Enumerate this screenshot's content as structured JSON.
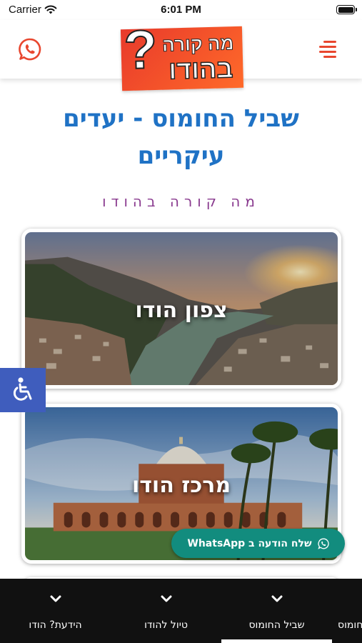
{
  "status_bar": {
    "carrier": "Carrier",
    "time": "6:01 PM"
  },
  "header": {
    "logo_line1": "מה קורה",
    "logo_line2": "בהודו",
    "logo_mark": "?",
    "whatsapp_icon": "whatsapp-icon",
    "menu_icon": "hamburger-menu-icon"
  },
  "page": {
    "title_line1": "שביל החומוס - יעדים",
    "title_line2": "עיקריים",
    "subtitle": "מה קורה בהודו"
  },
  "cards": [
    {
      "label": "צפון הודו"
    },
    {
      "label": "מרכז הודו"
    }
  ],
  "whatsapp_cta": {
    "label": "שלח הודעה ב WhatsApp"
  },
  "bottom_nav": {
    "items": [
      {
        "label": "הידעת? הודו"
      },
      {
        "label": "טיול להודו"
      },
      {
        "label": "שביל החומוס"
      },
      {
        "label": "חומוס"
      }
    ],
    "active": "שביל החומוס"
  },
  "colors": {
    "title_blue": "#1f72c5",
    "subtitle_purple": "#8a3b8f",
    "brand_orange": "#e8472f",
    "whatsapp_green": "#128c7e",
    "accessibility_blue": "#3f5dbd",
    "nav_bg": "#111111"
  }
}
